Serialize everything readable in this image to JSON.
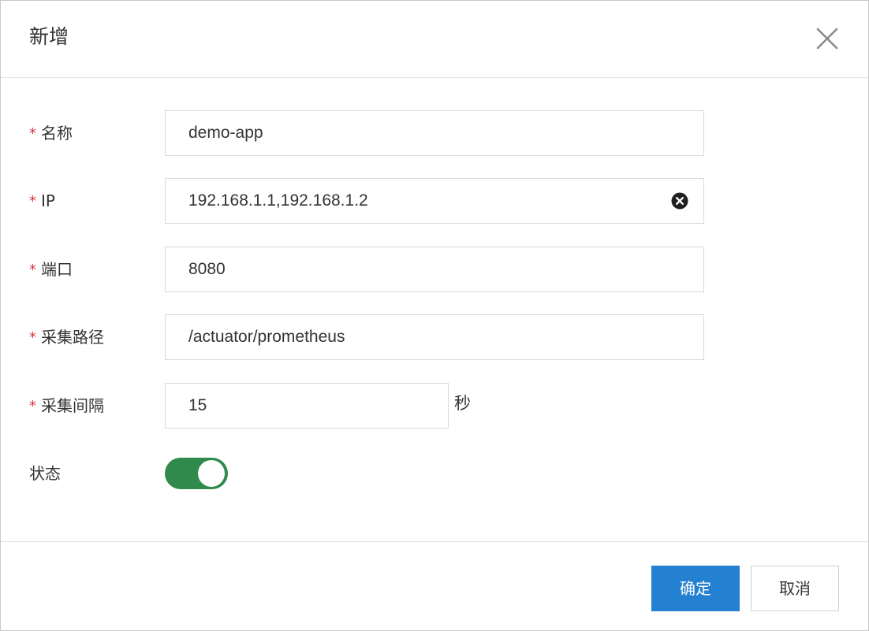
{
  "dialog": {
    "title": "新增",
    "close_icon": "close-icon"
  },
  "form": {
    "name": {
      "label": "名称",
      "required_mark": "*",
      "value": "demo-app"
    },
    "ip": {
      "label": "IP",
      "required_mark": "*",
      "value": "192.168.1.1,192.168.1.2",
      "clear_icon": "clear-circle-icon"
    },
    "port": {
      "label": "端口",
      "required_mark": "*",
      "value": "8080"
    },
    "path": {
      "label": "采集路径",
      "required_mark": "*",
      "value": "/actuator/prometheus"
    },
    "interval": {
      "label": "采集间隔",
      "required_mark": "*",
      "value": "15",
      "unit": "秒"
    },
    "status": {
      "label": "状态",
      "enabled": true,
      "color_on": "#2f8a4c"
    }
  },
  "footer": {
    "confirm_label": "确定",
    "cancel_label": "取消",
    "confirm_color": "#2480d1"
  }
}
